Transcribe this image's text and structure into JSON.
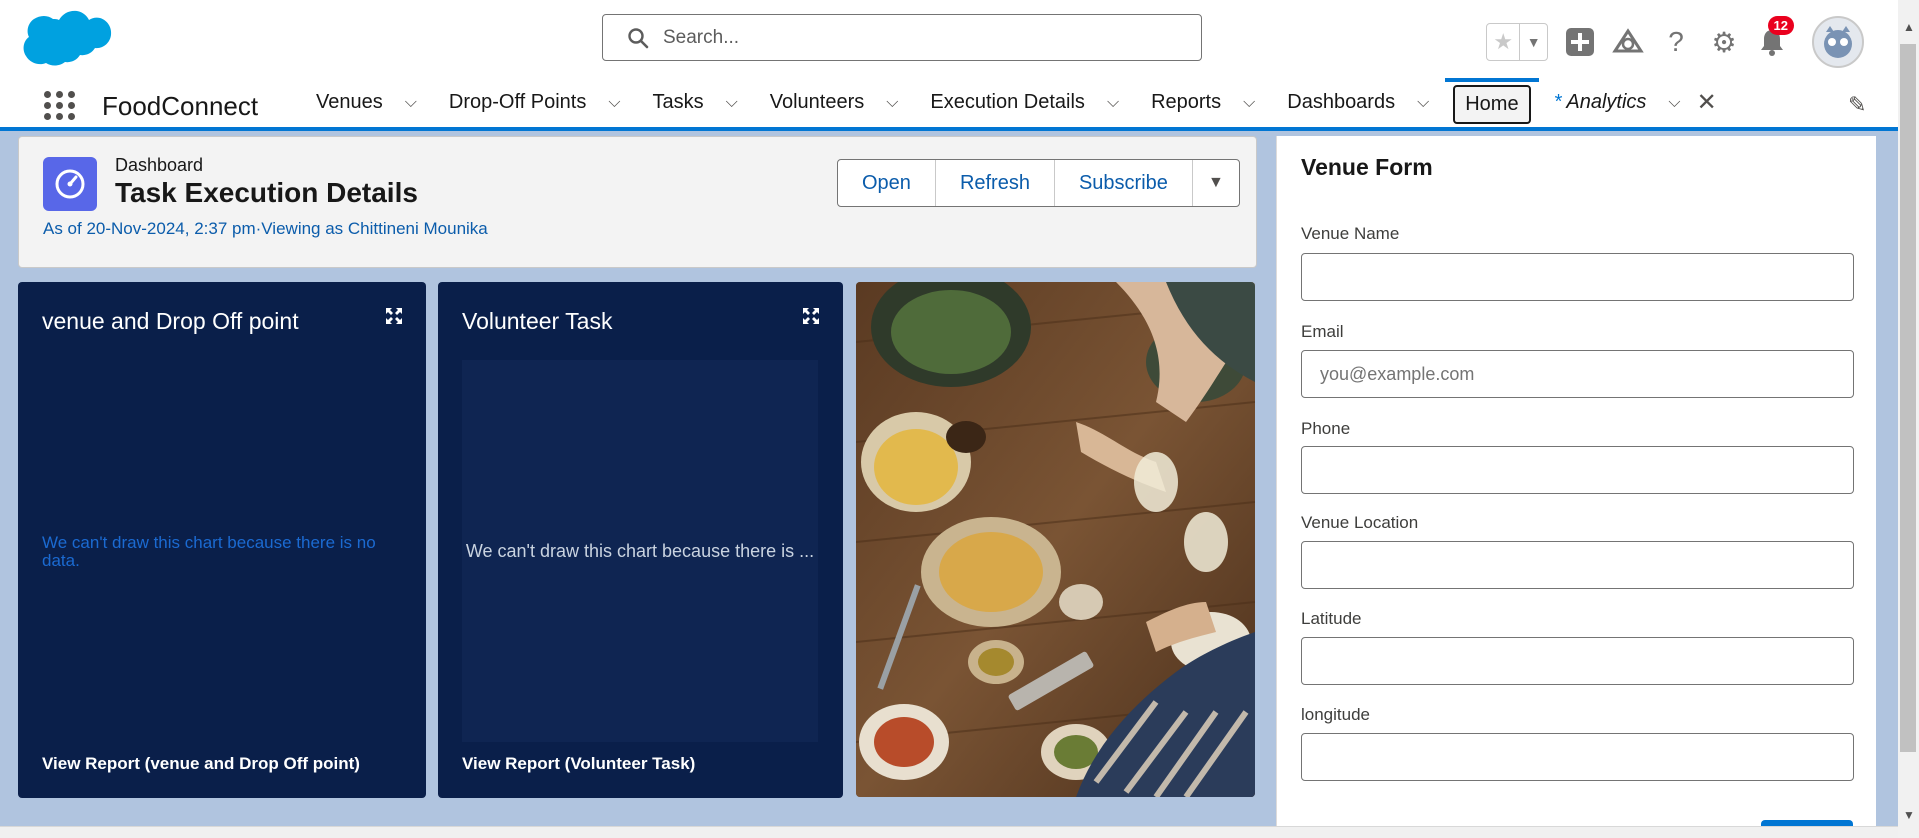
{
  "header": {
    "search_placeholder": "Search...",
    "notification_count": "12"
  },
  "nav": {
    "app_name": "FoodConnect",
    "items": [
      {
        "label": "Venues"
      },
      {
        "label": "Drop-Off Points"
      },
      {
        "label": "Tasks"
      },
      {
        "label": "Volunteers"
      },
      {
        "label": "Execution Details"
      },
      {
        "label": "Reports"
      },
      {
        "label": "Dashboards"
      }
    ],
    "home_label": "Home",
    "analytics_tab": {
      "marker": "*",
      "label": "Analytics"
    }
  },
  "dashboard": {
    "type_label": "Dashboard",
    "title": "Task Execution Details",
    "meta": "As of 20-Nov-2024, 2:37 pm·Viewing as Chittineni Mounika",
    "buttons": {
      "open": "Open",
      "refresh": "Refresh",
      "subscribe": "Subscribe"
    }
  },
  "widgets": [
    {
      "title": "venue and Drop Off point",
      "empty_message": "We can't draw this chart because there is no data.",
      "report_link": "View Report (venue and Drop Off point)"
    },
    {
      "title": "Volunteer Task",
      "empty_message": "We can't draw this chart because there is ...",
      "report_link": "View Report (Volunteer Task)"
    }
  ],
  "venue_form": {
    "title": "Venue Form",
    "fields": [
      {
        "label": "Venue Name",
        "value": "",
        "placeholder": ""
      },
      {
        "label": "Email",
        "value": "",
        "placeholder": "you@example.com"
      },
      {
        "label": "Phone",
        "value": "",
        "placeholder": ""
      },
      {
        "label": "Venue Location",
        "value": "",
        "placeholder": ""
      },
      {
        "label": "Latitude",
        "value": "",
        "placeholder": ""
      },
      {
        "label": "longitude",
        "value": "",
        "placeholder": ""
      }
    ]
  },
  "colors": {
    "brand_blue": "#0176d3",
    "widget_bg": "#0a1f4a",
    "page_bg": "#b0c4df",
    "badge_red": "#ea001e",
    "dashboard_icon": "#5867e8"
  }
}
